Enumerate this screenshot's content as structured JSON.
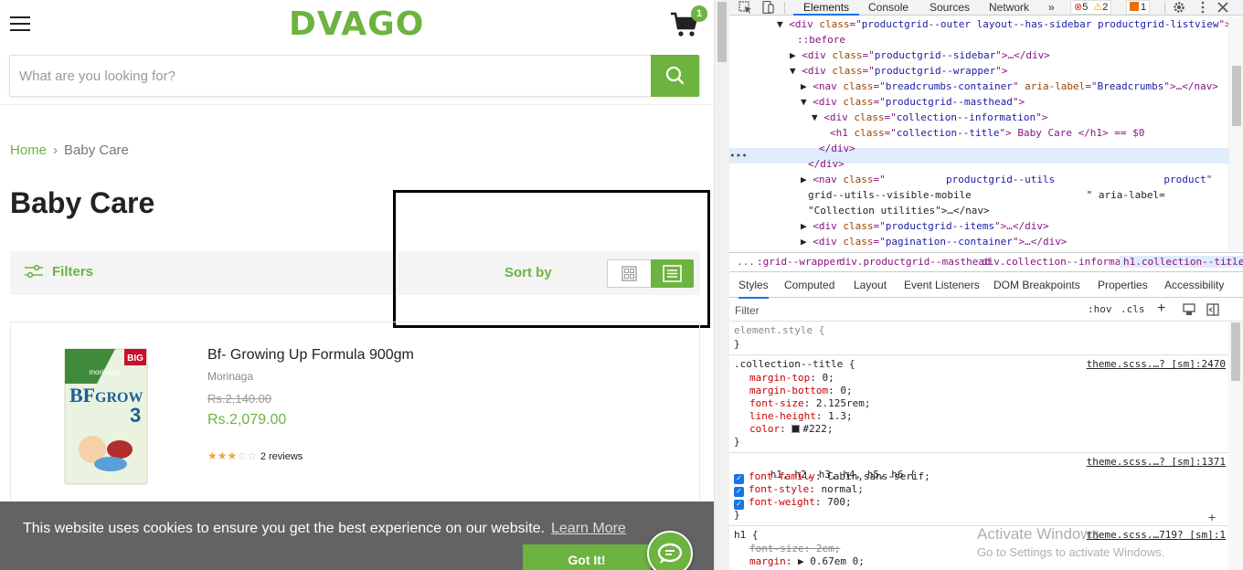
{
  "site": {
    "logo": "DVAGO",
    "cart_count": "1",
    "search_placeholder": "What are you looking for?",
    "breadcrumb": {
      "home": "Home",
      "separator": "›",
      "current": "Baby Care"
    },
    "page_title": "Baby Care",
    "utilities": {
      "filters_label": "Filters",
      "sort_label": "Sort by",
      "view_mode": "list"
    },
    "product": {
      "name": "Bf- Growing Up Formula 900gm",
      "brand": "Morinaga",
      "old_price": "Rs.2,140.00",
      "price": "Rs.2,079.00",
      "rating": 3,
      "rating_max": 5,
      "reviews": "2 reviews",
      "image_text": {
        "badge": "BIG",
        "brand": "morinaga",
        "line1": "BF",
        "line2": "GROW",
        "num": "3"
      }
    },
    "cookie": {
      "message": "This website uses cookies to ensure you get the best experience on our website.",
      "learn_more": "Learn More",
      "accept": "Got It!"
    },
    "accent_color": "#6db33f"
  },
  "devtools": {
    "tabs": [
      "Elements",
      "Console",
      "Sources",
      "Network",
      "»"
    ],
    "active_tab": "Elements",
    "errors": "5",
    "warnings": "2",
    "issues": "1",
    "dom_lines": [
      {
        "pre": "▼",
        "tag": "div",
        "attrs": [
          [
            "class",
            "productgrid--outer layout--has-sidebar productgrid-listview"
          ]
        ],
        "suffix": ">"
      },
      {
        "pre": "",
        "pseudo": "::before"
      },
      {
        "pre": "▶",
        "tag": "div",
        "attrs": [
          [
            "class",
            "productgrid--sidebar"
          ]
        ],
        "suffix": ">…</div>"
      },
      {
        "pre": "▼",
        "tag": "div",
        "attrs": [
          [
            "class",
            "productgrid--wrapper"
          ]
        ],
        "suffix": ">"
      },
      {
        "pre": "▶",
        "tag": "nav",
        "attrs": [
          [
            "class",
            "breadcrumbs-container"
          ],
          [
            "aria-label",
            "Breadcrumbs"
          ]
        ],
        "suffix": ">…</nav>"
      },
      {
        "pre": "▼",
        "tag": "div",
        "attrs": [
          [
            "class",
            "productgrid--masthead"
          ]
        ],
        "suffix": ">"
      },
      {
        "pre": "▼",
        "tag": "div",
        "attrs": [
          [
            "class",
            "collection--information"
          ]
        ],
        "suffix": ">"
      },
      {
        "pre": "",
        "tag": "h1",
        "attrs": [
          [
            "class",
            "collection--title"
          ]
        ],
        "suffix": "> Baby Care </h1> == $0"
      },
      {
        "pre": "",
        "close": "</div>"
      },
      {
        "pre": "",
        "close": "</div>"
      },
      {
        "pre": "▶",
        "tag": "nav",
        "attrs": [
          [
            "class",
            "          productgrid--utils                  product"
          ]
        ],
        "suffix": ""
      },
      {
        "pre": "",
        "raw": "grid--utils--visible-mobile                   \" aria-label="
      },
      {
        "pre": "",
        "raw": "\"Collection utilities\">…</nav>"
      },
      {
        "pre": "▶",
        "tag": "div",
        "attrs": [
          [
            "class",
            "productgrid--items"
          ]
        ],
        "suffix": ">…</div>"
      },
      {
        "pre": "▶",
        "tag": "div",
        "attrs": [
          [
            "class",
            "pagination--container"
          ]
        ],
        "suffix": ">…</div>"
      }
    ],
    "breadcrumbs": [
      "...",
      ":grid--wrapper",
      "div.productgrid--masthead",
      "div.collection--information",
      "h1.collection--title",
      "..."
    ],
    "style_tabs": [
      "Styles",
      "Computed",
      "Layout",
      "Event Listeners",
      "DOM Breakpoints",
      "Properties",
      "Accessibility"
    ],
    "filter_placeholder": "Filter",
    "hov": ":hov",
    "cls": ".cls",
    "rules": {
      "element_style": "element.style {",
      "close": "}",
      "collection_selector": ".collection--title {",
      "collection_link": "theme.scss.…? [sm]:2470",
      "collection_props": [
        {
          "prop": "margin-top",
          "val": "0;"
        },
        {
          "prop": "margin-bottom",
          "val": "0;"
        },
        {
          "prop": "font-size",
          "val": "2.125rem;"
        },
        {
          "prop": "line-height",
          "val": "1.3;"
        },
        {
          "prop": "color",
          "val": "#222;"
        }
      ],
      "headings_selector": "h1, h2, h3, h4, h5, h6 {",
      "headings_link": "theme.scss.…? [sm]:1371",
      "headings_props": [
        {
          "prop": "font-family",
          "val": "Cabin,sans-serif;"
        },
        {
          "prop": "font-style",
          "val": "normal;"
        },
        {
          "prop": "font-weight",
          "val": "700;"
        }
      ],
      "h1_selector": "h1 {",
      "h1_link": "theme.scss.…719? [sm]:1",
      "h1_props": [
        {
          "prop": "font-size",
          "val": "2em;"
        },
        {
          "prop": "margin",
          "val": "▶ 0.67em 0;"
        }
      ]
    },
    "watermark": {
      "line1": "Activate Windows",
      "line2": "Go to Settings to activate Windows."
    }
  }
}
